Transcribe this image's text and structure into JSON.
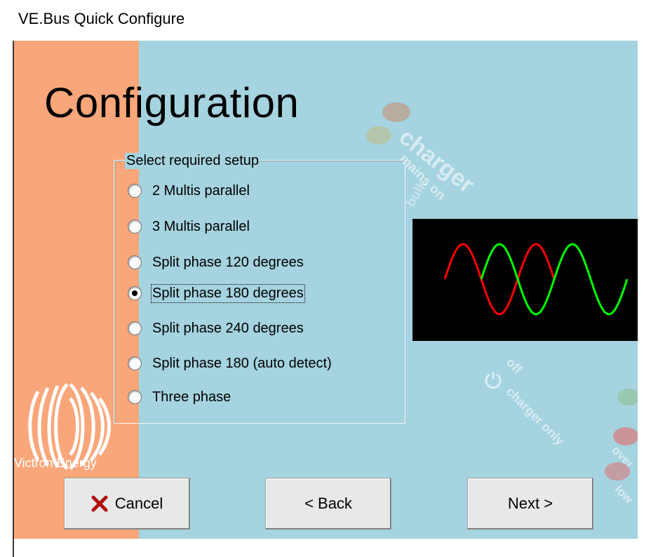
{
  "window": {
    "title": "VE.Bus Quick Configure"
  },
  "page": {
    "heading": "Configuration"
  },
  "background": {
    "brand": "Victron Energy",
    "decorations": [
      "charger",
      "mains on",
      "bulk",
      "off",
      "charger only",
      "over",
      "low"
    ]
  },
  "setup": {
    "group_label": "Select required setup",
    "options": [
      {
        "label": "2 Multis parallel",
        "selected": false
      },
      {
        "label": "3 Multis parallel",
        "selected": false
      },
      {
        "label": "Split phase 120 degrees",
        "selected": false
      },
      {
        "label": "Split phase 180 degrees",
        "selected": true
      },
      {
        "label": "Split phase 240 degrees",
        "selected": false
      },
      {
        "label": "Split phase 180 (auto detect)",
        "selected": false
      },
      {
        "label": "Three phase",
        "selected": false
      }
    ]
  },
  "waveform_preview": {
    "icon": "sine-waveform",
    "phase_shift_degrees": 180,
    "colors": [
      "#ff0000",
      "#00ff00"
    ],
    "background": "#000000"
  },
  "buttons": {
    "cancel": {
      "label": "Cancel",
      "icon": "red-x-icon"
    },
    "back": {
      "label": "< Back"
    },
    "next": {
      "label": "Next >"
    }
  },
  "colors": {
    "panel_background": "#a5d3e0",
    "accent_strip": "#f9a67a",
    "button_face": "#e8e8e8"
  }
}
